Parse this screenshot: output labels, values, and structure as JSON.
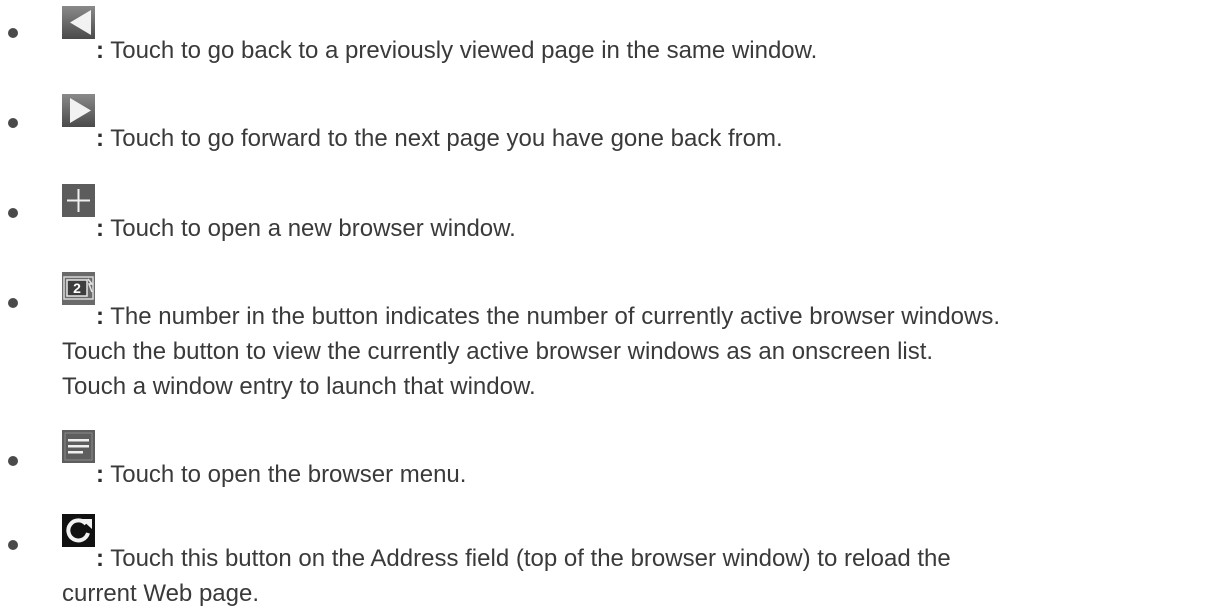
{
  "items": [
    {
      "icon": "back-arrow-icon",
      "colon": ":",
      "lines": [
        "Touch to go back to a previously viewed page in the same window."
      ]
    },
    {
      "icon": "forward-arrow-icon",
      "colon": ":",
      "lines": [
        "Touch to go forward to the next page you have gone back from."
      ]
    },
    {
      "icon": "plus-icon",
      "colon": ":",
      "lines": [
        "Touch to open a new browser window."
      ]
    },
    {
      "icon": "windows-count-icon",
      "icon_number": "2",
      "colon": ":",
      "lines": [
        "The number in the button indicates the number of currently active browser windows.",
        "Touch the button to view the currently active browser windows as an onscreen list.",
        "Touch a window entry to launch that window."
      ]
    },
    {
      "icon": "menu-icon",
      "colon": ":",
      "lines": [
        "Touch to open the browser menu."
      ]
    },
    {
      "icon": "refresh-icon",
      "colon": ":",
      "lines": [
        "Touch this button on the Address field (top of the browser window) to reload the",
        "current Web page."
      ]
    }
  ]
}
